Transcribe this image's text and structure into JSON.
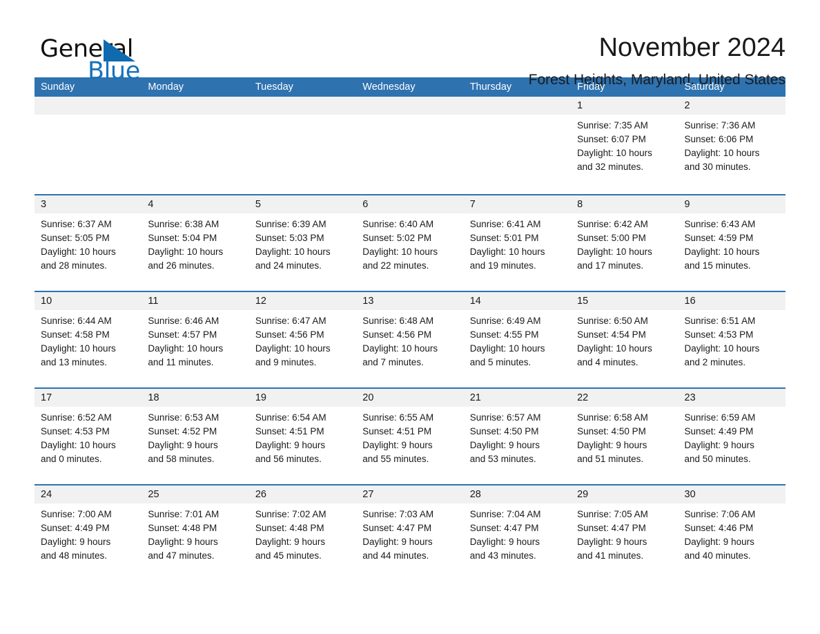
{
  "logo": {
    "word1": "General",
    "word2": "Blue",
    "triangle_color": "#0f6ab0",
    "blue_text_color": "#1672bc"
  },
  "header": {
    "title": "November 2024",
    "subtitle": "Forest Heights, Maryland, United States"
  },
  "theme": {
    "header_blue": "#2e72b0",
    "day_band_gray": "#f1f1f1",
    "text_color": "#1a1a1a"
  },
  "calendar": {
    "weekday_headers": [
      "Sunday",
      "Monday",
      "Tuesday",
      "Wednesday",
      "Thursday",
      "Friday",
      "Saturday"
    ],
    "weeks": [
      [
        {
          "day": "",
          "lines": []
        },
        {
          "day": "",
          "lines": []
        },
        {
          "day": "",
          "lines": []
        },
        {
          "day": "",
          "lines": []
        },
        {
          "day": "",
          "lines": []
        },
        {
          "day": "1",
          "lines": [
            "Sunrise: 7:35 AM",
            "Sunset: 6:07 PM",
            "Daylight: 10 hours",
            "and 32 minutes."
          ]
        },
        {
          "day": "2",
          "lines": [
            "Sunrise: 7:36 AM",
            "Sunset: 6:06 PM",
            "Daylight: 10 hours",
            "and 30 minutes."
          ]
        }
      ],
      [
        {
          "day": "3",
          "lines": [
            "Sunrise: 6:37 AM",
            "Sunset: 5:05 PM",
            "Daylight: 10 hours",
            "and 28 minutes."
          ]
        },
        {
          "day": "4",
          "lines": [
            "Sunrise: 6:38 AM",
            "Sunset: 5:04 PM",
            "Daylight: 10 hours",
            "and 26 minutes."
          ]
        },
        {
          "day": "5",
          "lines": [
            "Sunrise: 6:39 AM",
            "Sunset: 5:03 PM",
            "Daylight: 10 hours",
            "and 24 minutes."
          ]
        },
        {
          "day": "6",
          "lines": [
            "Sunrise: 6:40 AM",
            "Sunset: 5:02 PM",
            "Daylight: 10 hours",
            "and 22 minutes."
          ]
        },
        {
          "day": "7",
          "lines": [
            "Sunrise: 6:41 AM",
            "Sunset: 5:01 PM",
            "Daylight: 10 hours",
            "and 19 minutes."
          ]
        },
        {
          "day": "8",
          "lines": [
            "Sunrise: 6:42 AM",
            "Sunset: 5:00 PM",
            "Daylight: 10 hours",
            "and 17 minutes."
          ]
        },
        {
          "day": "9",
          "lines": [
            "Sunrise: 6:43 AM",
            "Sunset: 4:59 PM",
            "Daylight: 10 hours",
            "and 15 minutes."
          ]
        }
      ],
      [
        {
          "day": "10",
          "lines": [
            "Sunrise: 6:44 AM",
            "Sunset: 4:58 PM",
            "Daylight: 10 hours",
            "and 13 minutes."
          ]
        },
        {
          "day": "11",
          "lines": [
            "Sunrise: 6:46 AM",
            "Sunset: 4:57 PM",
            "Daylight: 10 hours",
            "and 11 minutes."
          ]
        },
        {
          "day": "12",
          "lines": [
            "Sunrise: 6:47 AM",
            "Sunset: 4:56 PM",
            "Daylight: 10 hours",
            "and 9 minutes."
          ]
        },
        {
          "day": "13",
          "lines": [
            "Sunrise: 6:48 AM",
            "Sunset: 4:56 PM",
            "Daylight: 10 hours",
            "and 7 minutes."
          ]
        },
        {
          "day": "14",
          "lines": [
            "Sunrise: 6:49 AM",
            "Sunset: 4:55 PM",
            "Daylight: 10 hours",
            "and 5 minutes."
          ]
        },
        {
          "day": "15",
          "lines": [
            "Sunrise: 6:50 AM",
            "Sunset: 4:54 PM",
            "Daylight: 10 hours",
            "and 4 minutes."
          ]
        },
        {
          "day": "16",
          "lines": [
            "Sunrise: 6:51 AM",
            "Sunset: 4:53 PM",
            "Daylight: 10 hours",
            "and 2 minutes."
          ]
        }
      ],
      [
        {
          "day": "17",
          "lines": [
            "Sunrise: 6:52 AM",
            "Sunset: 4:53 PM",
            "Daylight: 10 hours",
            "and 0 minutes."
          ]
        },
        {
          "day": "18",
          "lines": [
            "Sunrise: 6:53 AM",
            "Sunset: 4:52 PM",
            "Daylight: 9 hours",
            "and 58 minutes."
          ]
        },
        {
          "day": "19",
          "lines": [
            "Sunrise: 6:54 AM",
            "Sunset: 4:51 PM",
            "Daylight: 9 hours",
            "and 56 minutes."
          ]
        },
        {
          "day": "20",
          "lines": [
            "Sunrise: 6:55 AM",
            "Sunset: 4:51 PM",
            "Daylight: 9 hours",
            "and 55 minutes."
          ]
        },
        {
          "day": "21",
          "lines": [
            "Sunrise: 6:57 AM",
            "Sunset: 4:50 PM",
            "Daylight: 9 hours",
            "and 53 minutes."
          ]
        },
        {
          "day": "22",
          "lines": [
            "Sunrise: 6:58 AM",
            "Sunset: 4:50 PM",
            "Daylight: 9 hours",
            "and 51 minutes."
          ]
        },
        {
          "day": "23",
          "lines": [
            "Sunrise: 6:59 AM",
            "Sunset: 4:49 PM",
            "Daylight: 9 hours",
            "and 50 minutes."
          ]
        }
      ],
      [
        {
          "day": "24",
          "lines": [
            "Sunrise: 7:00 AM",
            "Sunset: 4:49 PM",
            "Daylight: 9 hours",
            "and 48 minutes."
          ]
        },
        {
          "day": "25",
          "lines": [
            "Sunrise: 7:01 AM",
            "Sunset: 4:48 PM",
            "Daylight: 9 hours",
            "and 47 minutes."
          ]
        },
        {
          "day": "26",
          "lines": [
            "Sunrise: 7:02 AM",
            "Sunset: 4:48 PM",
            "Daylight: 9 hours",
            "and 45 minutes."
          ]
        },
        {
          "day": "27",
          "lines": [
            "Sunrise: 7:03 AM",
            "Sunset: 4:47 PM",
            "Daylight: 9 hours",
            "and 44 minutes."
          ]
        },
        {
          "day": "28",
          "lines": [
            "Sunrise: 7:04 AM",
            "Sunset: 4:47 PM",
            "Daylight: 9 hours",
            "and 43 minutes."
          ]
        },
        {
          "day": "29",
          "lines": [
            "Sunrise: 7:05 AM",
            "Sunset: 4:47 PM",
            "Daylight: 9 hours",
            "and 41 minutes."
          ]
        },
        {
          "day": "30",
          "lines": [
            "Sunrise: 7:06 AM",
            "Sunset: 4:46 PM",
            "Daylight: 9 hours",
            "and 40 minutes."
          ]
        }
      ]
    ]
  }
}
